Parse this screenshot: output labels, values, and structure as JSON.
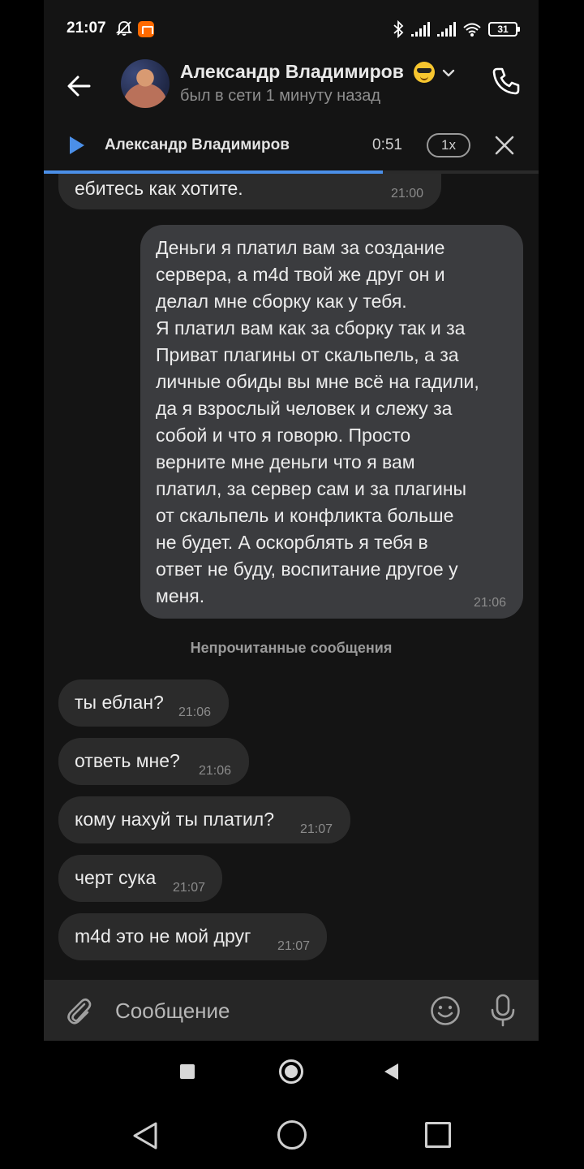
{
  "status_bar": {
    "time": "21:07",
    "battery": "31",
    "icons": [
      "bell-off-icon",
      "mi-app-icon",
      "bluetooth-icon",
      "signal-icon",
      "signal-icon",
      "wifi-icon",
      "battery-icon"
    ]
  },
  "header": {
    "contact_name": "Александр Владимиров",
    "contact_emoji": "sunglasses-emoji",
    "status": "был в сети 1 минуту назад"
  },
  "audio_player": {
    "author": "Александр Владимиров",
    "time": "0:51",
    "speed": "1x",
    "progress_fraction": 0.685
  },
  "messages": [
    {
      "direction": "in",
      "text": "ебитесь как хотите.",
      "time": "21:00"
    },
    {
      "direction": "out",
      "text": "Деньги я платил вам за создание\nсервера, а m4d твой же друг он и\nделал мне сборку как у тебя.\nЯ платил вам как за сборку так и за\nПриват плагины от скальпель, а за\nличные обиды вы мне всё на гадили,\nда я взрослый человек и слежу за\nсобой и что я говорю. Просто\nверните мне деньги что я вам\nплатил, за сервер сам и за плагины\nот скальпель и конфликта больше\nне будет. А оскорблять я тебя в\nответ не буду, воспитание другое у\nменя.",
      "time": "21:06"
    },
    {
      "direction": "in",
      "text": "ты еблан?",
      "time": "21:06"
    },
    {
      "direction": "in",
      "text": "ответь мне?",
      "time": "21:06"
    },
    {
      "direction": "in",
      "text": "кому нахуй ты платил?",
      "time": "21:07"
    },
    {
      "direction": "in",
      "text": "черт сука",
      "time": "21:07"
    },
    {
      "direction": "in",
      "text": "m4d это не мой друг",
      "time": "21:07"
    }
  ],
  "unread_divider": "Непрочитанные сообщения",
  "composer": {
    "placeholder": "Сообщение"
  },
  "colors": {
    "background": "#141414",
    "incoming_bubble": "#2b2b2b",
    "outgoing_bubble": "#3b3c3f",
    "accent": "#4b8fe8"
  }
}
